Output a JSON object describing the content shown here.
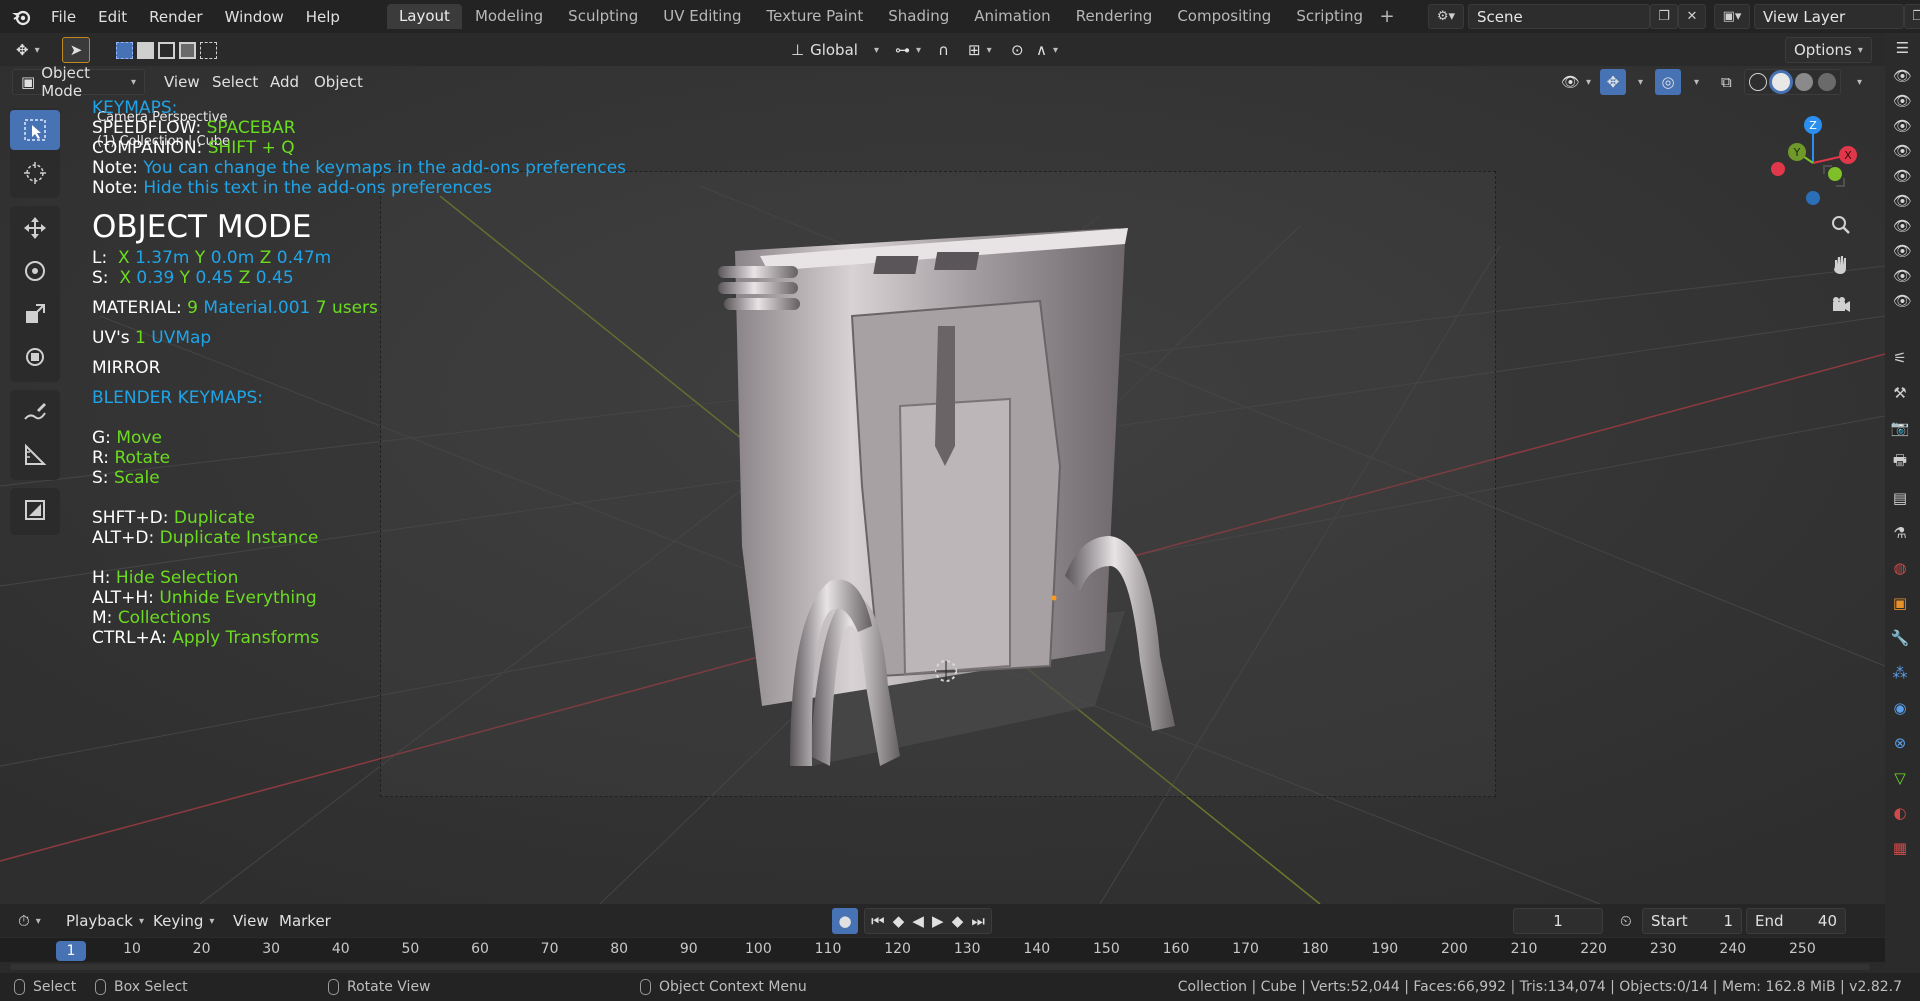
{
  "topbar": {
    "menu": [
      "File",
      "Edit",
      "Render",
      "Window",
      "Help"
    ],
    "workspaces": [
      "Layout",
      "Modeling",
      "Sculpting",
      "UV Editing",
      "Texture Paint",
      "Shading",
      "Animation",
      "Rendering",
      "Compositing",
      "Scripting"
    ],
    "active_workspace": "Layout",
    "scene_name": "Scene",
    "view_layer": "View Layer"
  },
  "toolheader": {
    "orientation": "Global",
    "options_label": "Options"
  },
  "viewport_header": {
    "mode": "Object Mode",
    "menus": [
      "View",
      "Select",
      "Add",
      "Object"
    ]
  },
  "viewport_info": {
    "camera": "Camera Perspective",
    "collection": "(1) Collection | Cube"
  },
  "overlay": {
    "keymaps_title": "KEYMAPS:",
    "speedflow_label": "SPEEDFLOW:",
    "speedflow_key": "SPACEBAR",
    "companion_label": "COMPANION:",
    "companion_key": "SHIFT + Q",
    "note1_label": "Note:",
    "note1_text": "You can change the keymaps in the add-ons preferences",
    "note2_label": "Note:",
    "note2_text": "Hide this text in the add-ons preferences",
    "mode_title": "OBJECT MODE",
    "loc_label": "L:",
    "loc_x_label": "X",
    "loc_x": "1.37m",
    "loc_y_label": "Y",
    "loc_y": "0.0m",
    "loc_z_label": "Z",
    "loc_z": "0.47m",
    "scale_label": "S:",
    "scale_x_label": "X",
    "scale_x": "0.39",
    "scale_y_label": "Y",
    "scale_y": "0.45",
    "scale_z_label": "Z",
    "scale_z": "0.45",
    "material_label": "MATERIAL:",
    "material_count": "9",
    "material_name": "Material.001",
    "material_users": "7 users",
    "uv_label": "UV's",
    "uv_count": "1",
    "uv_name": "UVMap",
    "mirror": "MIRROR",
    "blender_keymaps": "BLENDER KEYMAPS:",
    "shortcuts": [
      {
        "key": "G:",
        "action": "Move"
      },
      {
        "key": "R:",
        "action": "Rotate"
      },
      {
        "key": "S:",
        "action": "Scale"
      },
      {
        "key": "SHFT+D:",
        "action": "Duplicate"
      },
      {
        "key": "ALT+D:",
        "action": "Duplicate Instance"
      },
      {
        "key": "H:",
        "action": "Hide Selection"
      },
      {
        "key": "ALT+H:",
        "action": "Unhide Everything"
      },
      {
        "key": "M:",
        "action": "Collections"
      },
      {
        "key": "CTRL+A:",
        "action": "Apply Transforms"
      }
    ]
  },
  "gizmo": {
    "x": "X",
    "y": "Y",
    "z": "Z"
  },
  "timeline": {
    "menus": [
      "Playback",
      "Keying",
      "View",
      "Marker"
    ],
    "current_frame": "1",
    "start_label": "Start",
    "start": "1",
    "end_label": "End",
    "end": "40",
    "ruler_current": "1",
    "ticks": [
      "10",
      "20",
      "30",
      "40",
      "50",
      "60",
      "70",
      "80",
      "90",
      "100",
      "110",
      "120",
      "130",
      "140",
      "150",
      "160",
      "170",
      "180",
      "190",
      "200",
      "210",
      "220",
      "230",
      "240",
      "250"
    ]
  },
  "statusbar": {
    "select": "Select",
    "box_select": "Box Select",
    "rotate_view": "Rotate View",
    "context_menu": "Object Context Menu",
    "stats": "Collection | Cube | Verts:52,044 | Faces:66,992 | Tris:134,074 | Objects:0/14 | Mem: 162.8 MiB | v2.82.7"
  },
  "colors": {
    "accent": "#4772b3",
    "overlay_blue": "#1fa4e8",
    "overlay_green": "#6bdc1f",
    "axis_x": "#e0384a",
    "axis_y": "#7fbf2a",
    "axis_z": "#2b8ff0"
  }
}
